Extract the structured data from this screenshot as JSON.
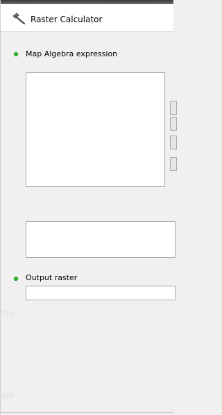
{
  "window": {
    "title": "Raster Calculator",
    "title_icon": "hammer-icon"
  },
  "map_algebra": {
    "label": "Map Algebra expression",
    "status_color": "#2bbf2b",
    "expression_value": ""
  },
  "output_raster": {
    "label": "Output raster",
    "status_color": "#2bbf2b",
    "value": ""
  }
}
